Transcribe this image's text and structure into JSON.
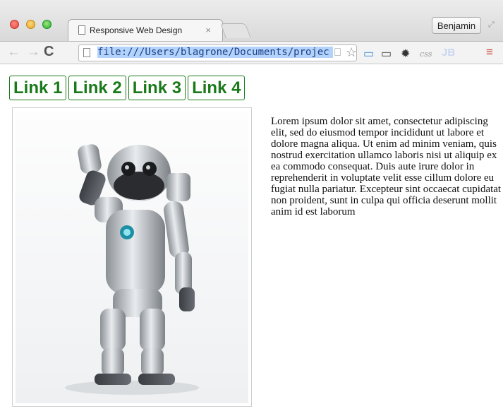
{
  "browser": {
    "tab": {
      "title": "Responsive Web Design",
      "close": "×"
    },
    "profile": "Benjamin",
    "address": {
      "url": "file:///Users/blagrone/Documents/projec"
    },
    "icons": {
      "window_controls": [
        "close-icon",
        "minimize-icon",
        "maximize-icon"
      ],
      "nav": [
        "back-icon",
        "forward-icon",
        "reload-icon"
      ],
      "extensions": [
        "screen-icon",
        "ruler-icon",
        "gear-icon",
        "css-icon",
        "jb-icon",
        "menu-icon"
      ]
    },
    "extension_labels": {
      "css": "css",
      "jb": "JB"
    }
  },
  "page": {
    "nav_links": [
      "Link 1",
      "Link 2",
      "Link 3",
      "Link 4"
    ],
    "image": {
      "subject": "robot-waving"
    },
    "text": "Lorem ipsum dolor sit amet, consectetur adipiscing elit, sed do eiusmod tempor incididunt ut labore et dolore magna aliqua. Ut enim ad minim veniam, quis nostrud exercitation ullamco laboris nisi ut aliquip ex ea commodo consequat. Duis aute irure dolor in reprehenderit in voluptate velit esse cillum dolore eu fugiat nulla pariatur. Excepteur sint occaecat cupidatat non proident, sunt in culpa qui officia deserunt mollit anim id est laborum"
  },
  "colors": {
    "link": "#1a7a1a",
    "url_highlight": "#b3d3fb"
  }
}
